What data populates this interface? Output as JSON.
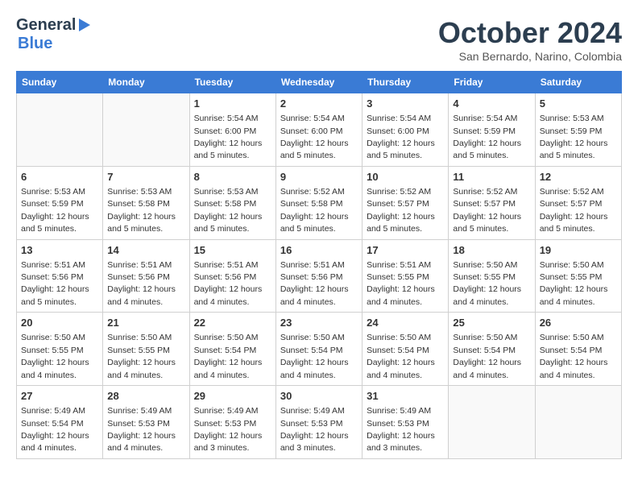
{
  "header": {
    "logo_general": "General",
    "logo_blue": "Blue",
    "title": "October 2024",
    "location": "San Bernardo, Narino, Colombia"
  },
  "calendar": {
    "days_of_week": [
      "Sunday",
      "Monday",
      "Tuesday",
      "Wednesday",
      "Thursday",
      "Friday",
      "Saturday"
    ],
    "weeks": [
      [
        {
          "day": "",
          "info": ""
        },
        {
          "day": "",
          "info": ""
        },
        {
          "day": "1",
          "info": "Sunrise: 5:54 AM\nSunset: 6:00 PM\nDaylight: 12 hours and 5 minutes."
        },
        {
          "day": "2",
          "info": "Sunrise: 5:54 AM\nSunset: 6:00 PM\nDaylight: 12 hours and 5 minutes."
        },
        {
          "day": "3",
          "info": "Sunrise: 5:54 AM\nSunset: 6:00 PM\nDaylight: 12 hours and 5 minutes."
        },
        {
          "day": "4",
          "info": "Sunrise: 5:54 AM\nSunset: 5:59 PM\nDaylight: 12 hours and 5 minutes."
        },
        {
          "day": "5",
          "info": "Sunrise: 5:53 AM\nSunset: 5:59 PM\nDaylight: 12 hours and 5 minutes."
        }
      ],
      [
        {
          "day": "6",
          "info": "Sunrise: 5:53 AM\nSunset: 5:59 PM\nDaylight: 12 hours and 5 minutes."
        },
        {
          "day": "7",
          "info": "Sunrise: 5:53 AM\nSunset: 5:58 PM\nDaylight: 12 hours and 5 minutes."
        },
        {
          "day": "8",
          "info": "Sunrise: 5:53 AM\nSunset: 5:58 PM\nDaylight: 12 hours and 5 minutes."
        },
        {
          "day": "9",
          "info": "Sunrise: 5:52 AM\nSunset: 5:58 PM\nDaylight: 12 hours and 5 minutes."
        },
        {
          "day": "10",
          "info": "Sunrise: 5:52 AM\nSunset: 5:57 PM\nDaylight: 12 hours and 5 minutes."
        },
        {
          "day": "11",
          "info": "Sunrise: 5:52 AM\nSunset: 5:57 PM\nDaylight: 12 hours and 5 minutes."
        },
        {
          "day": "12",
          "info": "Sunrise: 5:52 AM\nSunset: 5:57 PM\nDaylight: 12 hours and 5 minutes."
        }
      ],
      [
        {
          "day": "13",
          "info": "Sunrise: 5:51 AM\nSunset: 5:56 PM\nDaylight: 12 hours and 5 minutes."
        },
        {
          "day": "14",
          "info": "Sunrise: 5:51 AM\nSunset: 5:56 PM\nDaylight: 12 hours and 4 minutes."
        },
        {
          "day": "15",
          "info": "Sunrise: 5:51 AM\nSunset: 5:56 PM\nDaylight: 12 hours and 4 minutes."
        },
        {
          "day": "16",
          "info": "Sunrise: 5:51 AM\nSunset: 5:56 PM\nDaylight: 12 hours and 4 minutes."
        },
        {
          "day": "17",
          "info": "Sunrise: 5:51 AM\nSunset: 5:55 PM\nDaylight: 12 hours and 4 minutes."
        },
        {
          "day": "18",
          "info": "Sunrise: 5:50 AM\nSunset: 5:55 PM\nDaylight: 12 hours and 4 minutes."
        },
        {
          "day": "19",
          "info": "Sunrise: 5:50 AM\nSunset: 5:55 PM\nDaylight: 12 hours and 4 minutes."
        }
      ],
      [
        {
          "day": "20",
          "info": "Sunrise: 5:50 AM\nSunset: 5:55 PM\nDaylight: 12 hours and 4 minutes."
        },
        {
          "day": "21",
          "info": "Sunrise: 5:50 AM\nSunset: 5:55 PM\nDaylight: 12 hours and 4 minutes."
        },
        {
          "day": "22",
          "info": "Sunrise: 5:50 AM\nSunset: 5:54 PM\nDaylight: 12 hours and 4 minutes."
        },
        {
          "day": "23",
          "info": "Sunrise: 5:50 AM\nSunset: 5:54 PM\nDaylight: 12 hours and 4 minutes."
        },
        {
          "day": "24",
          "info": "Sunrise: 5:50 AM\nSunset: 5:54 PM\nDaylight: 12 hours and 4 minutes."
        },
        {
          "day": "25",
          "info": "Sunrise: 5:50 AM\nSunset: 5:54 PM\nDaylight: 12 hours and 4 minutes."
        },
        {
          "day": "26",
          "info": "Sunrise: 5:50 AM\nSunset: 5:54 PM\nDaylight: 12 hours and 4 minutes."
        }
      ],
      [
        {
          "day": "27",
          "info": "Sunrise: 5:49 AM\nSunset: 5:54 PM\nDaylight: 12 hours and 4 minutes."
        },
        {
          "day": "28",
          "info": "Sunrise: 5:49 AM\nSunset: 5:53 PM\nDaylight: 12 hours and 4 minutes."
        },
        {
          "day": "29",
          "info": "Sunrise: 5:49 AM\nSunset: 5:53 PM\nDaylight: 12 hours and 3 minutes."
        },
        {
          "day": "30",
          "info": "Sunrise: 5:49 AM\nSunset: 5:53 PM\nDaylight: 12 hours and 3 minutes."
        },
        {
          "day": "31",
          "info": "Sunrise: 5:49 AM\nSunset: 5:53 PM\nDaylight: 12 hours and 3 minutes."
        },
        {
          "day": "",
          "info": ""
        },
        {
          "day": "",
          "info": ""
        }
      ]
    ]
  }
}
